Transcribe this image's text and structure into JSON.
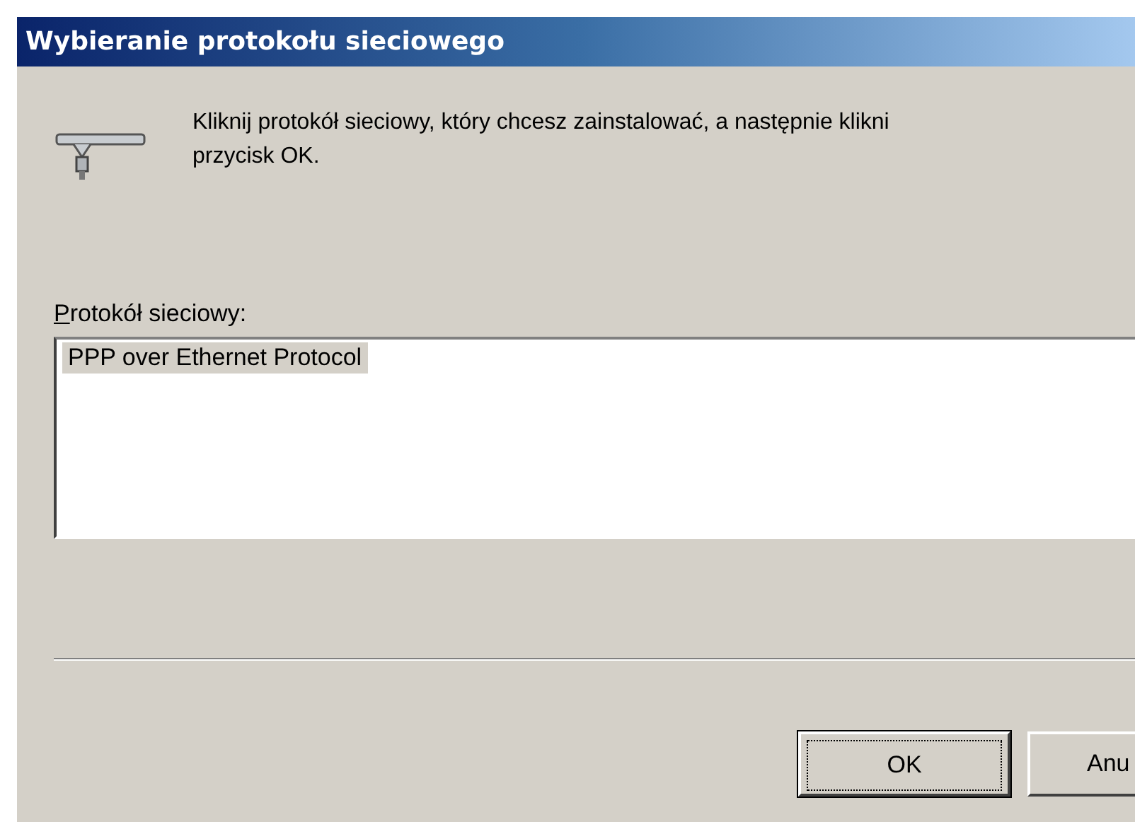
{
  "window": {
    "title": "Wybieranie protokołu sieciowego"
  },
  "instruction_lines": [
    "Kliknij protokół sieciowy, który chcesz zainstalować, a następnie klikni",
    "przycisk OK."
  ],
  "list": {
    "label": "Protokół sieciowy:",
    "mnemonic_underlined": true,
    "items": [
      {
        "text": "PPP over Ethernet Protocol",
        "selected": true
      }
    ]
  },
  "buttons": [
    {
      "label": "OK",
      "default": true
    },
    {
      "label": "Anu",
      "default": false
    }
  ]
}
